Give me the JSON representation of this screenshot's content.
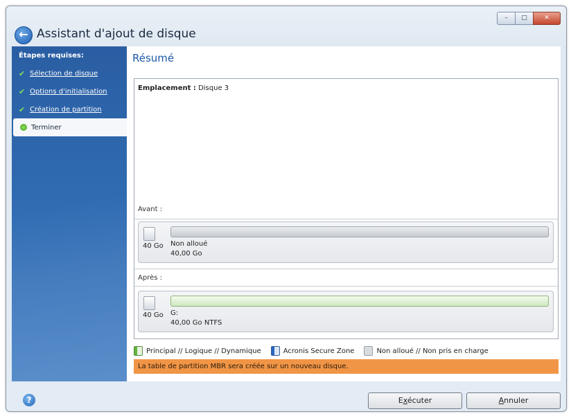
{
  "window": {
    "title": "Assistant d'ajout de disque",
    "controls": {
      "minimize": "–",
      "maximize": "□",
      "close": "✕"
    }
  },
  "sidebar": {
    "header": "Étapes requises:",
    "items": [
      {
        "label": "Sélection de disque",
        "state": "done"
      },
      {
        "label": "Options d'initialisation",
        "state": "done"
      },
      {
        "label": "Création de partition",
        "state": "done"
      },
      {
        "label": "Terminer",
        "state": "current"
      }
    ]
  },
  "main": {
    "title": "Résumé",
    "location_label": "Emplacement :",
    "location_value": "Disque 3",
    "before": {
      "label": "Avant :",
      "disk_size": "40 Go",
      "partition_name": "Non alloué",
      "partition_detail": "40,00 Go"
    },
    "after": {
      "label": "Après :",
      "disk_size": "40 Go",
      "partition_name": "G:",
      "partition_detail": "40,00 Go  NTFS"
    },
    "legend": [
      {
        "label": "Principal // Logique // Dynamique",
        "color": "#5fb53c"
      },
      {
        "label": "Acronis Secure Zone",
        "color": "#2a66c2"
      },
      {
        "label": "Non alloué // Non pris en charge",
        "color": "#d9dcdf"
      }
    ],
    "notice": "La table de partition MBR sera créée sur un nouveau disque.",
    "notice_color": "#f09545"
  },
  "footer": {
    "execute_prefix": "E",
    "execute_underlined": "x",
    "execute_rest": "écuter",
    "cancel_underlined": "A",
    "cancel_rest": "nnuler"
  }
}
